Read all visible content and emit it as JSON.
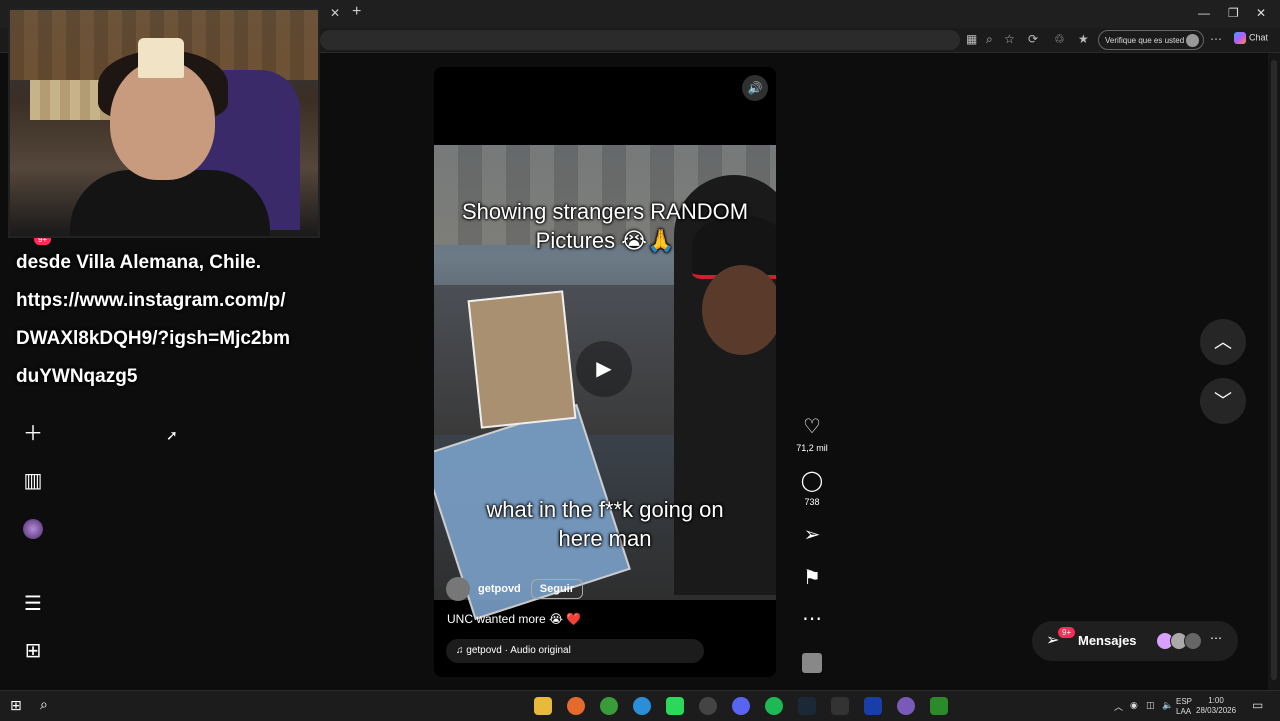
{
  "browser": {
    "tab_close": "✕",
    "tab_new": "+",
    "verify_label": "Verifique que es usted",
    "chat_label": "Chat",
    "window_controls": [
      "—",
      "❐",
      "✕"
    ]
  },
  "stream_overlay": {
    "lines": [
      "desde Villa Alemana, Chile.",
      "https://www.instagram.com/p/",
      "DWAXl8kDQH9/?igsh=Mjc2bm",
      "duYWNqazg5"
    ],
    "badge": "9+"
  },
  "sidebar": {
    "icons": [
      "create-icon",
      "dashboard-icon",
      "profile-icon",
      "menu-icon",
      "more-apps-icon"
    ]
  },
  "reel": {
    "caption_top": [
      "Showing strangers RANDOM",
      "Pictures 😭🙏"
    ],
    "caption_bottom": [
      "what in the f**k going on",
      "here man"
    ],
    "author": "getpovd",
    "follow_label": "Seguir",
    "description": "UNC wanted more 😭 ❤️",
    "audio": "♫ getpovd · Audio original",
    "play_glyph": "▶",
    "sound_glyph": "🔊"
  },
  "actions": {
    "likes": "71,2 mil",
    "comments": "738"
  },
  "messages": {
    "label": "Mensajes",
    "badge": "9+",
    "more": "⋯"
  },
  "taskbar": {
    "lang_top": "ESP",
    "lang_bottom": "LAA",
    "time": "1:00",
    "date": "28/03/2026"
  }
}
